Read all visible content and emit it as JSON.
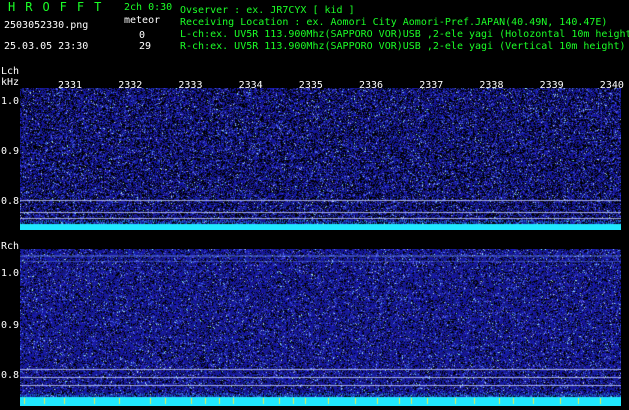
{
  "header": {
    "title": "HROFFT",
    "filename": "2503052330.png",
    "datetime": "25.03.05 23:30",
    "channel_interval": "2ch 0:30",
    "meteor_label": "meteor",
    "lch_count": "0",
    "rch_count": "29"
  },
  "info": [
    "Ovserver          : ex. JR7CYX [ kid ]",
    "Receiving Location : ex. Aomori City Aomori-Pref.JAPAN(40.49N, 140.47E)",
    "L-ch:ex. UV5R 113.900Mhz(SAPPORO VOR)USB ,2-ele yagi (Holozontal 10m height)",
    "R-ch:ex. UV5R 113.900Mhz(SAPPORO VOR)USB ,2-ele yagi (Vertical 10m height)"
  ],
  "left_panel": {
    "label": "Lch",
    "unit": "kHz",
    "y_labels": [
      "1.0",
      "0.9",
      "0.8"
    ]
  },
  "right_panel": {
    "label": "Rch",
    "y_labels": [
      "1.0",
      "0.9",
      "0.8"
    ]
  },
  "time_ticks": [
    "2331",
    "2332",
    "2333",
    "2334",
    "2335",
    "2336",
    "2337",
    "2338",
    "2339",
    "2340"
  ],
  "colors": {
    "background": "#000000",
    "header_green": "#1bff27",
    "noise_blue": "#1f22a8",
    "carrier_cyan": "#20e8ff"
  }
}
